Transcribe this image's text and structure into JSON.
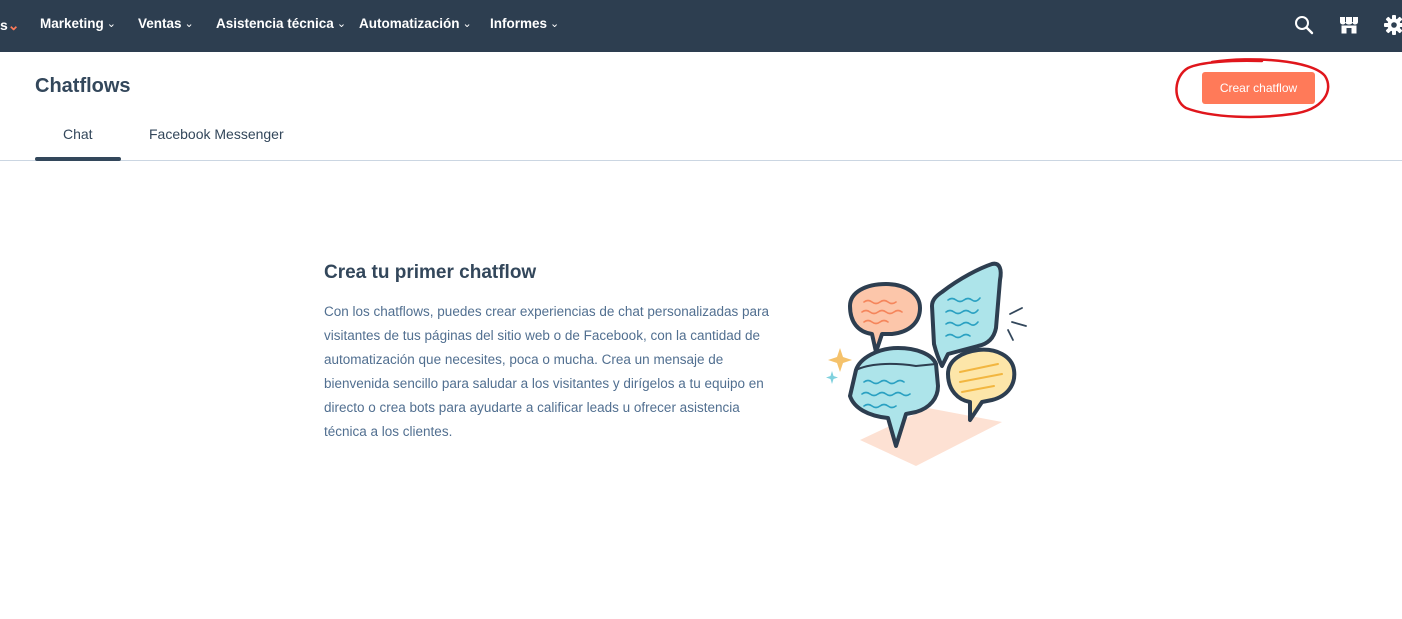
{
  "topnav": {
    "cut_label": "s",
    "items": [
      "Marketing",
      "Ventas",
      "Asistencia técnica",
      "Automatización",
      "Informes"
    ],
    "icons": [
      "search-icon",
      "marketplace-icon",
      "settings-icon"
    ]
  },
  "header": {
    "title": "Chatflows",
    "create_label": "Crear chatflow"
  },
  "tabs": [
    {
      "label": "Chat",
      "active": true
    },
    {
      "label": "Facebook Messenger",
      "active": false
    }
  ],
  "empty_state": {
    "title": "Crea tu primer chatflow",
    "body": "Con los chatflows, puedes crear experiencias de chat personalizadas para visitantes de tus páginas del sitio web o de Facebook, con la cantidad de automatización que necesites, poca o mucha. Crea un mensaje de bienvenida sencillo para saludar a los visitantes y dirígelos a tu equipo en directo o crea bots para ayudarte a calificar leads u ofrecer asistencia técnica a los clientes."
  },
  "colors": {
    "nav_bg": "#2d3e50",
    "accent": "#ff7a59",
    "text": "#33475b",
    "body_text": "#516f90",
    "annotation": "#e0161c"
  }
}
